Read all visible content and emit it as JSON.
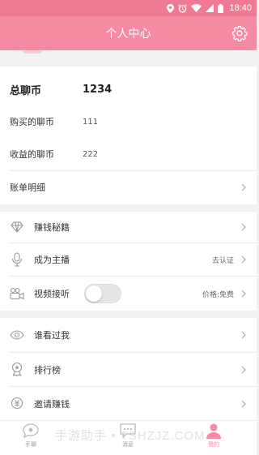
{
  "status_bar": {
    "time": "18:40"
  },
  "header": {
    "title": "个人中心",
    "settings_icon": "gear-icon"
  },
  "coins": {
    "total_label": "总聊币",
    "total_value": "1234",
    "purchased_label": "购买的聊币",
    "purchased_value": "111",
    "earned_label": "收益的聊币",
    "earned_value": "222",
    "statement_label": "账单明细"
  },
  "menu1": [
    {
      "label": "赚钱秘籍",
      "icon": "diamond-icon",
      "note": ""
    },
    {
      "label": "成为主播",
      "icon": "microphone-icon",
      "note": "去认证"
    },
    {
      "label": "视频接听",
      "icon": "video-camera-icon",
      "note": "价格:免费"
    }
  ],
  "menu2": [
    {
      "label": "谁看过我",
      "icon": "eye-icon"
    },
    {
      "label": "排行榜",
      "icon": "trophy-icon"
    },
    {
      "label": "邀请赚钱",
      "icon": "coin-icon"
    }
  ],
  "tabbar": [
    {
      "label": "手聊",
      "icon": "chat-bubble-icon"
    },
    {
      "label": "消息",
      "icon": "message-icon"
    },
    {
      "label": "我的",
      "icon": "person-icon"
    }
  ],
  "video_toggle_on": false,
  "watermark": "手游助手 • TSHZJZ.COM",
  "colors": {
    "primary": "#f58ba2",
    "status_bar": "#ef7a93",
    "background": "#f2f2f2"
  }
}
